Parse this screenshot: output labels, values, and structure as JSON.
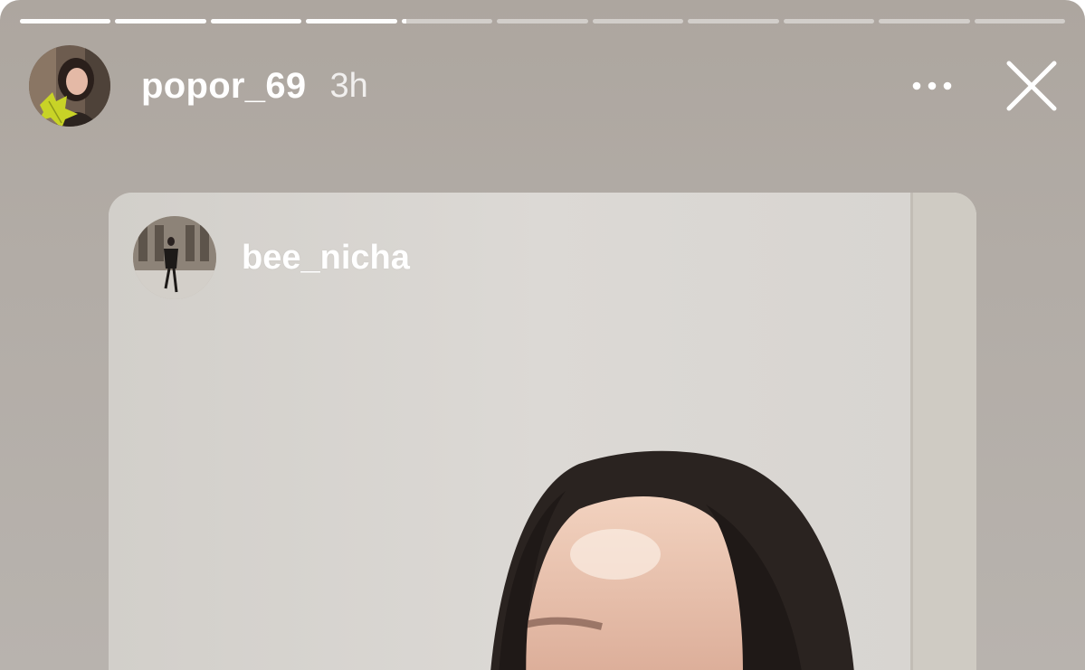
{
  "story": {
    "progress": {
      "segments": 11,
      "completed": 4,
      "current_fraction": 0.05
    },
    "header": {
      "username": "popor_69",
      "time": "3h",
      "avatar_icon": "profile-photo-avatar",
      "more_icon": "more-options-icon",
      "close_icon": "close-icon"
    },
    "shared_post": {
      "username": "bee_nicha",
      "avatar_icon": "profile-photo-avatar"
    }
  },
  "colors": {
    "background": "#b0aaa4",
    "progress_done": "#ffffff",
    "progress_pending": "rgba(255,255,255,0.45)",
    "text": "#ffffff"
  }
}
